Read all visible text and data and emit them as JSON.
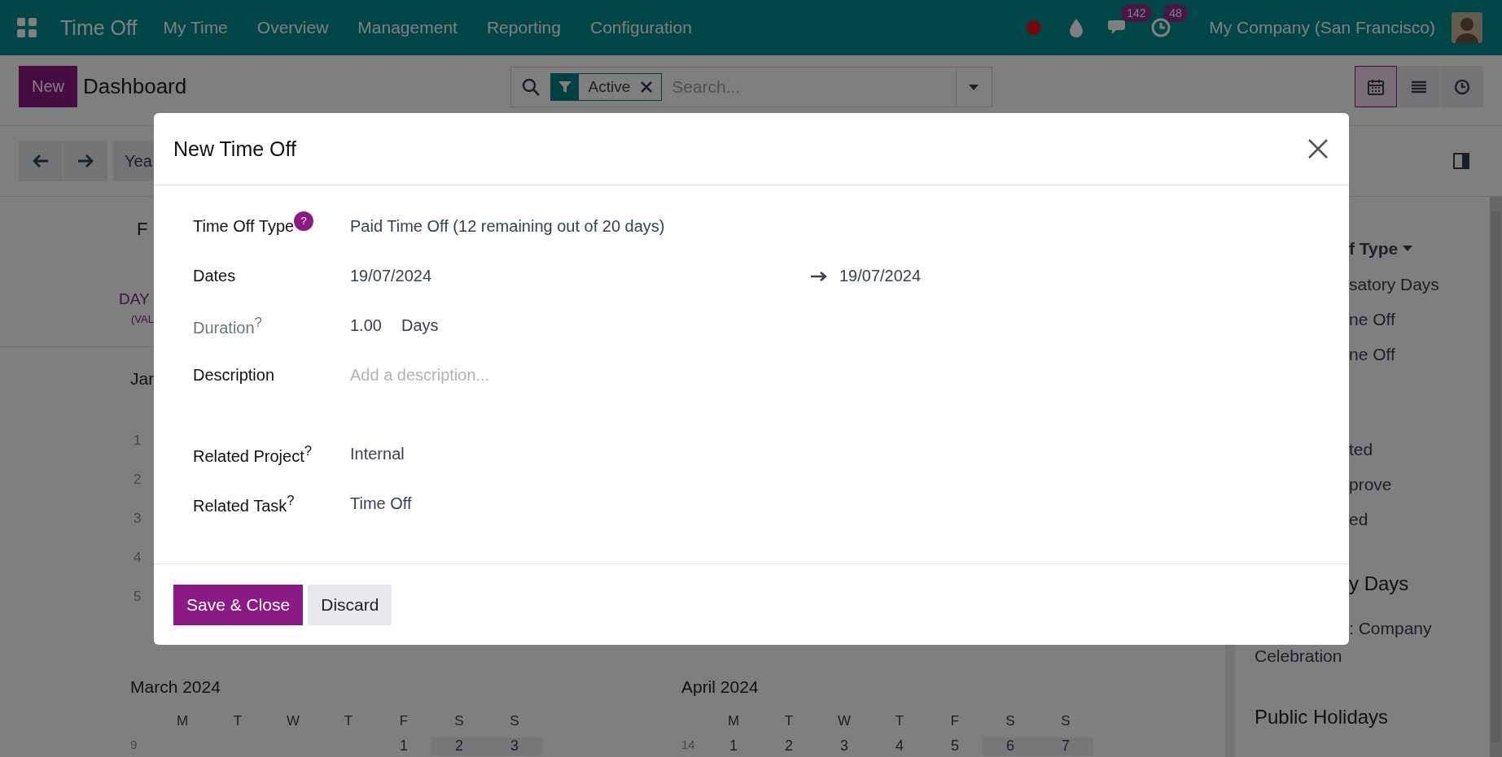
{
  "navbar": {
    "app_name": "Time Off",
    "menu": [
      "My Time",
      "Overview",
      "Management",
      "Reporting",
      "Configuration"
    ],
    "messages_count": "142",
    "activities_count": "48",
    "company": "My Company (San Francisco)"
  },
  "control_panel": {
    "new_button": "New",
    "title": "Dashboard",
    "search": {
      "facets": [
        {
          "label": "Active"
        }
      ],
      "placeholder": "Search..."
    },
    "views": [
      {
        "kind": "calendar",
        "selected": true
      },
      {
        "kind": "list",
        "selected": false
      },
      {
        "kind": "activity",
        "selected": false
      }
    ]
  },
  "calendar_toolbar": {
    "scale_button": "Yea"
  },
  "calendar": {
    "header_label": "F",
    "legend": "DAY",
    "legend_note": "(VAL",
    "first_month": "Jan",
    "first_month_weeks": [
      "1",
      "2",
      "3",
      "4",
      "5"
    ],
    "months": [
      {
        "title": "March 2024",
        "weekdays": [
          "M",
          "T",
          "W",
          "T",
          "F",
          "S",
          "S"
        ],
        "weeks": [
          {
            "number": "9",
            "days": [
              {
                "kind": "empty"
              },
              {
                "kind": "empty"
              },
              {
                "kind": "empty"
              },
              {
                "kind": "empty"
              },
              {
                "kind": "day",
                "day": "1"
              },
              {
                "kind": "day",
                "day": "2"
              },
              {
                "kind": "day",
                "day": "3"
              }
            ]
          }
        ]
      },
      {
        "title": "April 2024",
        "weekdays": [
          "M",
          "T",
          "W",
          "T",
          "F",
          "S",
          "S"
        ],
        "weeks": [
          {
            "number": "14",
            "days": [
              {
                "kind": "day",
                "day": "1"
              },
              {
                "kind": "day",
                "day": "2"
              },
              {
                "kind": "day",
                "day": "3"
              },
              {
                "kind": "day",
                "day": "4"
              },
              {
                "kind": "day",
                "day": "5"
              },
              {
                "kind": "day",
                "day": "6"
              },
              {
                "kind": "day",
                "day": "7"
              }
            ]
          }
        ]
      }
    ]
  },
  "side_panel": {
    "groups": [
      {
        "heading": {
          "text": "f Type",
          "kind": "filter",
          "cut": true
        },
        "items": [
          {
            "text": "satory Days",
            "cut": true
          },
          {
            "text": "ne Off",
            "cut": true
          },
          {
            "text": "ne Off",
            "cut": true
          }
        ]
      },
      {
        "items": [
          {
            "text": "ted",
            "cut": true
          },
          {
            "text": "prove",
            "cut": true
          },
          {
            "text": "ed",
            "cut": true
          }
        ]
      },
      {
        "heading": {
          "text": "y Days",
          "kind": "section",
          "cut": true
        },
        "items": [
          {
            "text": ": Company",
            "cut": true
          },
          {
            "text": "Celebration",
            "cut": false
          }
        ]
      },
      {
        "heading": {
          "text": "Public Holidays",
          "kind": "section",
          "cut": false
        }
      }
    ]
  },
  "dialog": {
    "title": "New Time Off",
    "fields": [
      {
        "label": "Time Off Type",
        "help_badge": "?",
        "kind": "select",
        "value": "Paid Time Off (12 remaining out of 20 days)",
        "readonly": false
      },
      {
        "label": "Dates",
        "kind": "daterange",
        "start": "19/07/2024",
        "end": "19/07/2024",
        "readonly": false
      },
      {
        "label": "Duration$^{?}$",
        "kind": "duration",
        "value": "1.00",
        "unit": "Days",
        "readonly": true
      },
      {
        "label": "Description",
        "kind": "textarea",
        "placeholder": "Add a description...",
        "readonly": false
      },
      {
        "label": "Related Project$^{?}$",
        "kind": "select",
        "value": "Internal",
        "readonly": false
      },
      {
        "label": "Related Task$^{?}$",
        "kind": "select",
        "value": "Time Off",
        "readonly": false
      }
    ],
    "buttons": [
      {
        "label": "Save & Close",
        "kind": "primary"
      },
      {
        "label": "Discard",
        "kind": "secondary"
      }
    ]
  }
}
